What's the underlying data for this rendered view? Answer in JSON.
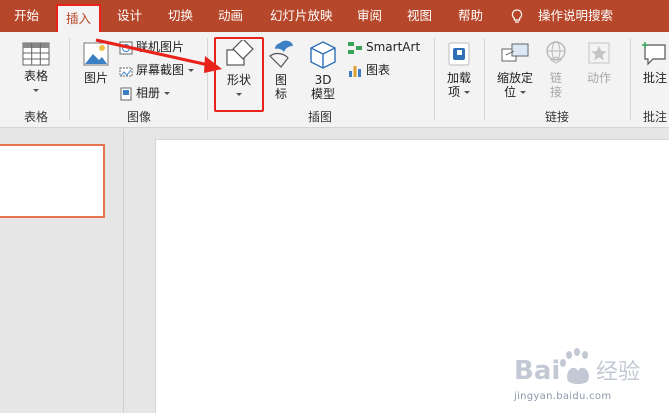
{
  "tabs": [
    {
      "label": "开始",
      "active": false
    },
    {
      "label": "插入",
      "active": true
    },
    {
      "label": "设计",
      "active": false
    },
    {
      "label": "切换",
      "active": false
    },
    {
      "label": "动画",
      "active": false
    },
    {
      "label": "幻灯片放映",
      "active": false
    },
    {
      "label": "审阅",
      "active": false
    },
    {
      "label": "视图",
      "active": false
    },
    {
      "label": "帮助",
      "active": false
    }
  ],
  "tell_me": "操作说明搜索",
  "groups": {
    "tables": {
      "label": "表格",
      "table_btn": "表格"
    },
    "images": {
      "label": "图像",
      "picture_btn": "图片",
      "online_pictures": "联机图片",
      "screenshot": "屏幕截图",
      "album": "相册"
    },
    "illustrations": {
      "label": "插图",
      "shapes_btn": "形状",
      "icons_btn_l1": "图",
      "icons_btn_l2": "标",
      "model3d_l1": "3D",
      "model3d_l2": "模型",
      "smartart": "SmartArt",
      "chart": "图表"
    },
    "addins": {
      "btn_l1": "加载",
      "btn_l2": "项"
    },
    "links": {
      "label": "链接",
      "zoom_l1": "缩放定",
      "zoom_l2": "位",
      "link_l1": "链",
      "link_l2": "接",
      "action": "动作"
    },
    "comments": {
      "label": "批注",
      "comment_btn": "批注"
    }
  },
  "colors": {
    "accent": "#b7472a",
    "highlight": "#e8231b"
  },
  "watermark": {
    "brand": "Bai 经验",
    "url": "jingyan.baidu.com"
  }
}
